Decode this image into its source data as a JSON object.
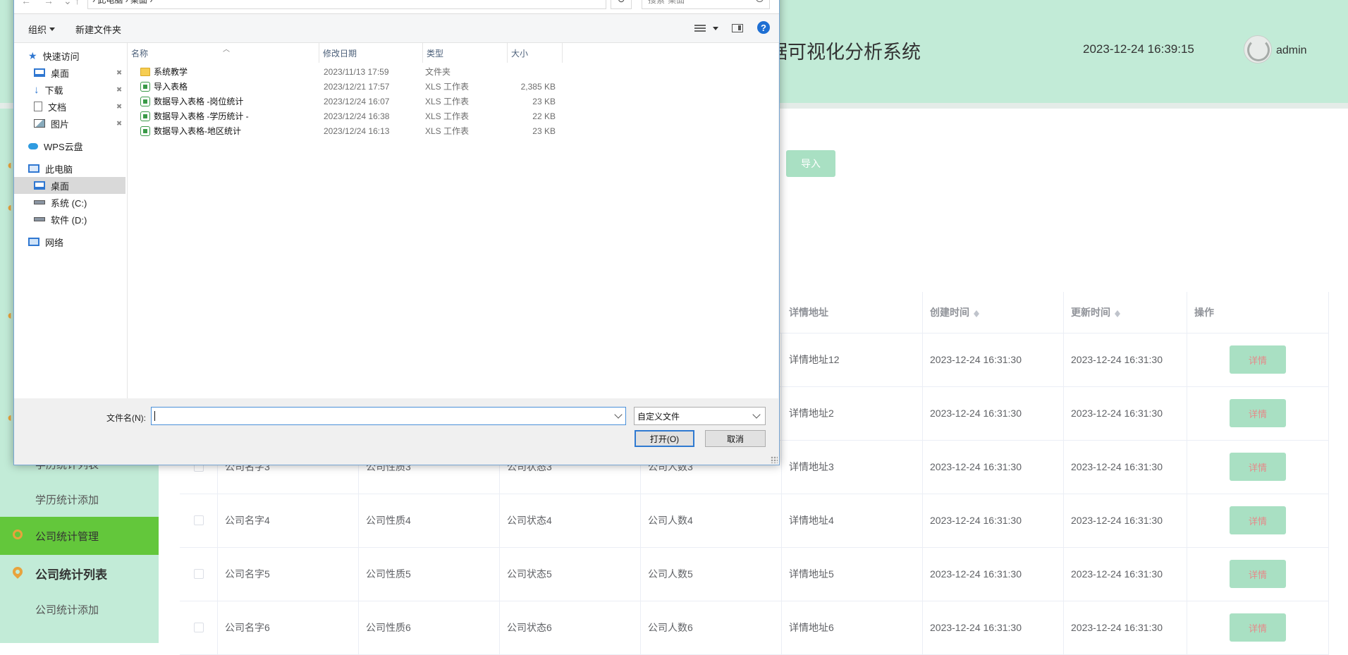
{
  "app": {
    "title": "据可视化分析系统",
    "clock": "2023-12-24 16:39:15",
    "user": "admin"
  },
  "sidebar": {
    "items": [
      {
        "label": "学历统计列表",
        "type": "sub"
      },
      {
        "label": "学历统计添加",
        "type": "sub"
      },
      {
        "label": "公司统计管理",
        "type": "active"
      },
      {
        "label": "公司统计列表",
        "type": "head"
      },
      {
        "label": "公司统计添加",
        "type": "sub"
      }
    ]
  },
  "page": {
    "import_label": "导入"
  },
  "table": {
    "headers": {
      "address": "详情地址",
      "created": "创建时间",
      "updated": "更新时间",
      "ops": "操作"
    },
    "detail_label": "详情",
    "rows": [
      {
        "name": "",
        "nature": "",
        "status": "",
        "count": "",
        "address": "详情地址12",
        "created": "2023-12-24 16:31:30",
        "updated": "2023-12-24 16:31:30"
      },
      {
        "name": "",
        "nature": "",
        "status": "",
        "count": "",
        "address": "详情地址2",
        "created": "2023-12-24 16:31:30",
        "updated": "2023-12-24 16:31:30"
      },
      {
        "name": "公司名字3",
        "nature": "公司性质3",
        "status": "公司状态3",
        "count": "公司人数3",
        "address": "详情地址3",
        "created": "2023-12-24 16:31:30",
        "updated": "2023-12-24 16:31:30"
      },
      {
        "name": "公司名字4",
        "nature": "公司性质4",
        "status": "公司状态4",
        "count": "公司人数4",
        "address": "详情地址4",
        "created": "2023-12-24 16:31:30",
        "updated": "2023-12-24 16:31:30"
      },
      {
        "name": "公司名字5",
        "nature": "公司性质5",
        "status": "公司状态5",
        "count": "公司人数5",
        "address": "详情地址5",
        "created": "2023-12-24 16:31:30",
        "updated": "2023-12-24 16:31:30"
      },
      {
        "name": "公司名字6",
        "nature": "公司性质6",
        "status": "公司状态6",
        "count": "公司人数6",
        "address": "详情地址6",
        "created": "2023-12-24 16:31:30",
        "updated": "2023-12-24 16:31:30"
      }
    ]
  },
  "dialog": {
    "address_path": "› 此电脑 › 桌面 ›",
    "search_placeholder": "搜索\"桌面\"",
    "toolbar": {
      "organize": "组织",
      "new_folder": "新建文件夹"
    },
    "nav": [
      {
        "label": "快速访问",
        "icon": "star",
        "indent": 0,
        "pinned": false
      },
      {
        "label": "桌面",
        "icon": "monitor",
        "indent": 1,
        "pinned": true
      },
      {
        "label": "下载",
        "icon": "down",
        "indent": 1,
        "pinned": true
      },
      {
        "label": "文档",
        "icon": "doc",
        "indent": 1,
        "pinned": true
      },
      {
        "label": "图片",
        "icon": "pic",
        "indent": 1,
        "pinned": true
      },
      {
        "label": "WPS云盘",
        "icon": "cloud",
        "indent": 0,
        "pinned": false
      },
      {
        "label": "此电脑",
        "icon": "pc",
        "indent": 0,
        "pinned": false
      },
      {
        "label": "桌面",
        "icon": "monitor",
        "indent": 1,
        "pinned": false,
        "selected": true
      },
      {
        "label": "系统 (C:)",
        "icon": "drive",
        "indent": 1,
        "pinned": false
      },
      {
        "label": "软件 (D:)",
        "icon": "drive",
        "indent": 1,
        "pinned": false
      },
      {
        "label": "网络",
        "icon": "net",
        "indent": 0,
        "pinned": false
      }
    ],
    "columns": {
      "name": "名称",
      "modified": "修改日期",
      "type": "类型",
      "size": "大小"
    },
    "files": [
      {
        "name": "系统教学",
        "modified": "2023/11/13 17:59",
        "type": "文件夹",
        "size": "",
        "icon": "folder"
      },
      {
        "name": "导入表格",
        "modified": "2023/12/21 17:57",
        "type": "XLS 工作表",
        "size": "2,385 KB",
        "icon": "xls"
      },
      {
        "name": "数据导入表格 -岗位统计",
        "modified": "2023/12/24 16:07",
        "type": "XLS 工作表",
        "size": "23 KB",
        "icon": "xls"
      },
      {
        "name": "数据导入表格 -学历统计 -",
        "modified": "2023/12/24 16:38",
        "type": "XLS 工作表",
        "size": "22 KB",
        "icon": "xls"
      },
      {
        "name": "数据导入表格-地区统计",
        "modified": "2023/12/24 16:13",
        "type": "XLS 工作表",
        "size": "23 KB",
        "icon": "xls"
      }
    ],
    "filename_label": "文件名(N):",
    "filename_value": "",
    "filetype_value": "自定义文件",
    "open_label": "打开(O)",
    "cancel_label": "取消"
  }
}
